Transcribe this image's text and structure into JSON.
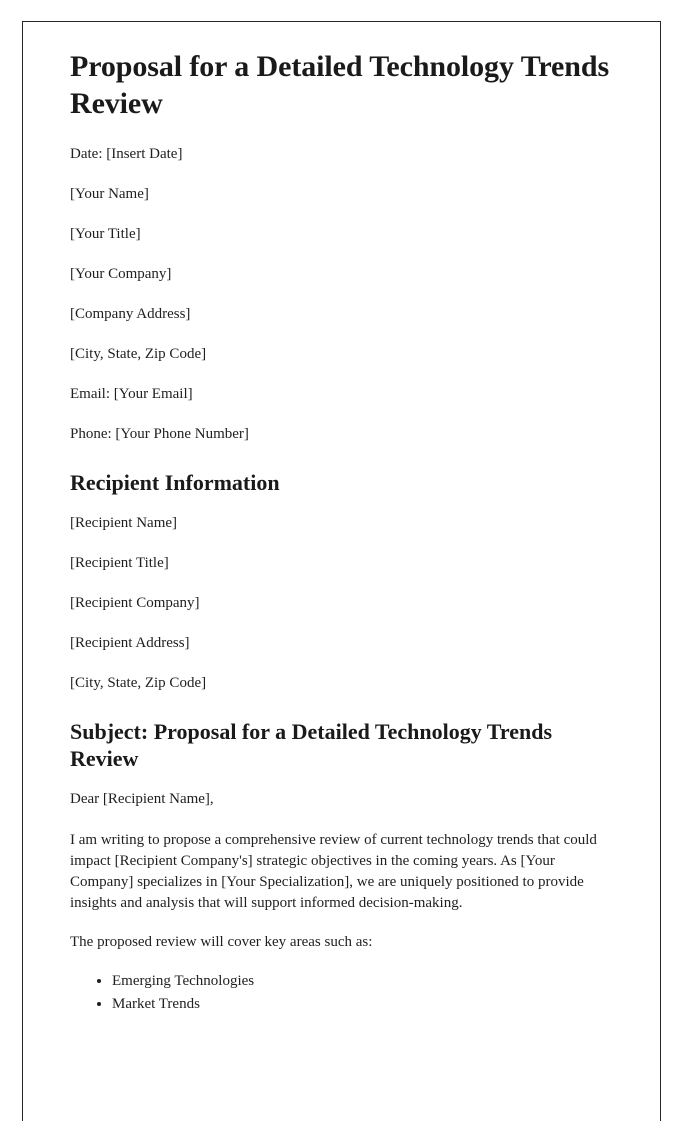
{
  "document": {
    "title": "Proposal for a Detailed Technology Trends Review",
    "sender": {
      "date_line": "Date: [Insert Date]",
      "name": "[Your Name]",
      "job_title": "[Your Title]",
      "company": "[Your Company]",
      "address": "[Company Address]",
      "city_state_zip": "[City, State, Zip Code]",
      "email_line": "Email: [Your Email]",
      "phone_line": "Phone: [Your Phone Number]"
    },
    "recipient_section": {
      "heading": "Recipient Information",
      "name": "[Recipient Name]",
      "job_title": "[Recipient Title]",
      "company": "[Recipient Company]",
      "address": "[Recipient Address]",
      "city_state_zip": "[City, State, Zip Code]"
    },
    "subject_section": {
      "heading": "Subject: Proposal for a Detailed Technology Trends Review",
      "salutation": "Dear [Recipient Name],",
      "paragraph_1": "I am writing to propose a comprehensive review of current technology trends that could impact [Recipient Company's] strategic objectives in the coming years. As [Your Company] specializes in [Your Specialization], we are uniquely positioned to provide insights and analysis that will support informed decision-making.",
      "paragraph_2": "The proposed review will cover key areas such as:",
      "key_areas": [
        "Emerging Technologies",
        "Market Trends"
      ]
    }
  }
}
